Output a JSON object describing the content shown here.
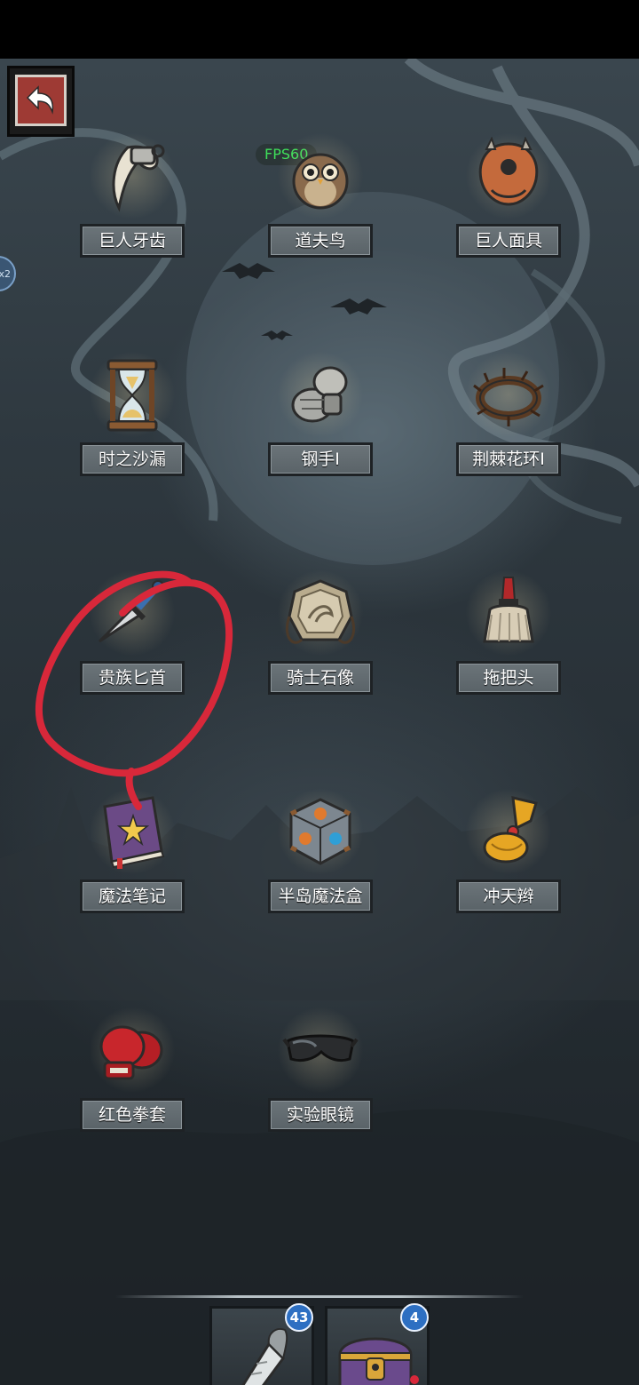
{
  "status": {
    "fps": "FPS60",
    "edge_badge": "x2"
  },
  "items": [
    {
      "name": "巨人牙齿",
      "icon": "giant-tooth-icon"
    },
    {
      "name": "道夫鸟",
      "icon": "owl-icon"
    },
    {
      "name": "巨人面具",
      "icon": "giant-mask-icon"
    },
    {
      "name": "时之沙漏",
      "icon": "hourglass-icon"
    },
    {
      "name": "钢手I",
      "icon": "steel-gauntlet-icon"
    },
    {
      "name": "荆棘花环I",
      "icon": "thorn-wreath-icon"
    },
    {
      "name": "贵族匕首",
      "icon": "noble-dagger-icon"
    },
    {
      "name": "骑士石像",
      "icon": "knight-statue-icon"
    },
    {
      "name": "拖把头",
      "icon": "mop-head-icon"
    },
    {
      "name": "魔法笔记",
      "icon": "magic-notebook-icon"
    },
    {
      "name": "半岛魔法盒",
      "icon": "magic-cube-icon"
    },
    {
      "name": "冲天辫",
      "icon": "ponytail-icon"
    },
    {
      "name": "红色拳套",
      "icon": "boxing-glove-icon"
    },
    {
      "name": "实验眼镜",
      "icon": "lab-goggles-icon"
    }
  ],
  "inventory": [
    {
      "icon": "carrot-icon",
      "count": "43"
    },
    {
      "icon": "treasure-chest-icon",
      "count": "4"
    }
  ],
  "colors": {
    "label_bg": "#62696e",
    "annotation": "#d8283a",
    "badge": "#2d6fc2",
    "fps": "#3ee05a"
  }
}
